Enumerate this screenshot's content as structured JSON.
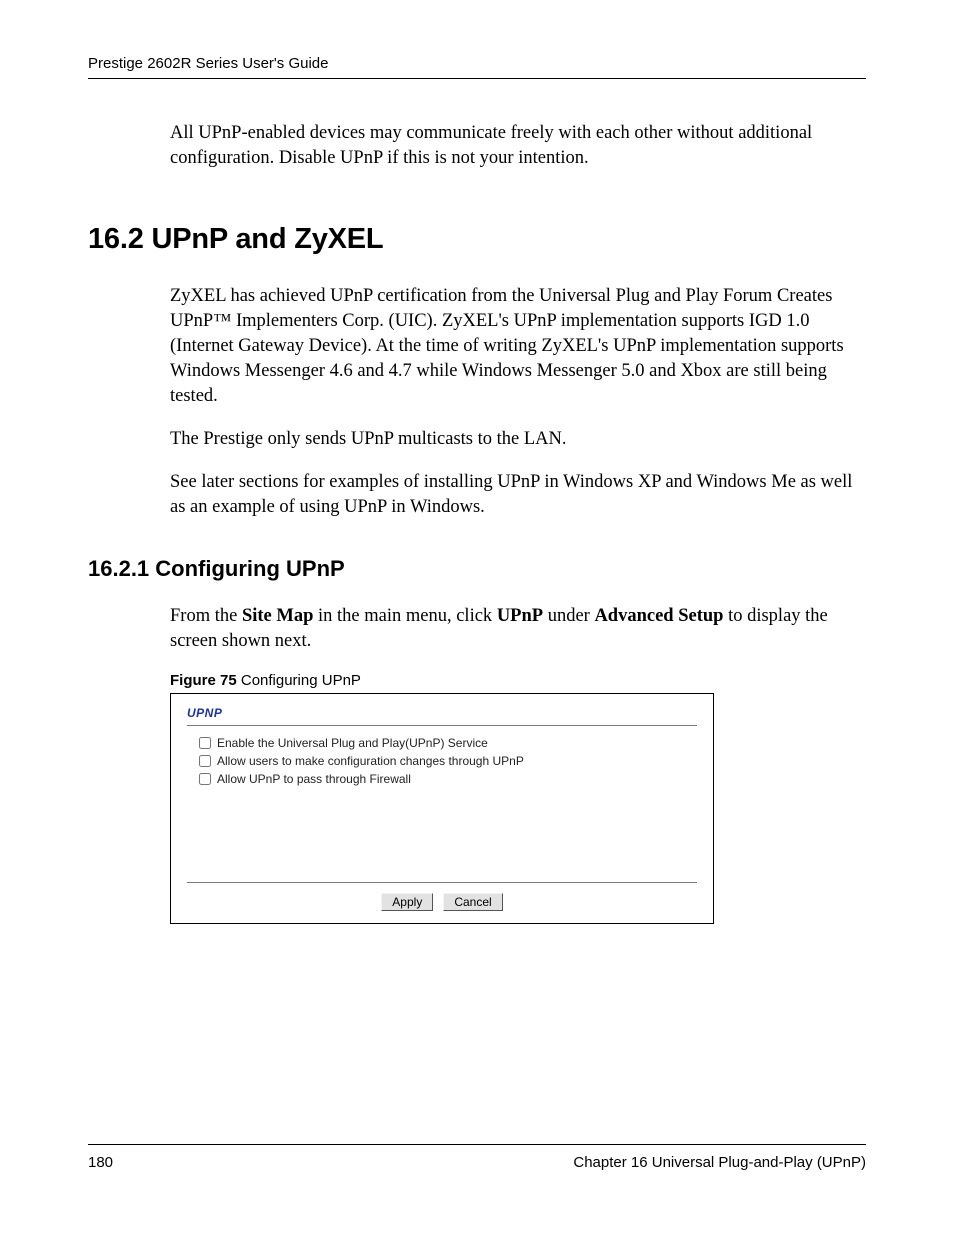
{
  "header": {
    "guide_title": "Prestige 2602R Series User's Guide"
  },
  "intro_para": "All UPnP-enabled devices may communicate freely with each other without additional configuration. Disable UPnP if this is not your intention.",
  "section_16_2": {
    "heading": "16.2  UPnP and ZyXEL",
    "para1": "ZyXEL has achieved UPnP certification from the Universal Plug and Play Forum Creates UPnP™ Implementers Corp. (UIC). ZyXEL's UPnP implementation supports IGD 1.0 (Internet Gateway Device). At the time of writing ZyXEL's UPnP implementation supports Windows Messenger 4.6 and 4.7 while Windows Messenger 5.0 and Xbox are still being tested.",
    "para2": "The Prestige only sends UPnP multicasts to the LAN.",
    "para3": "See later sections for examples of installing UPnP in Windows XP and Windows Me as well as an example of using UPnP in Windows."
  },
  "section_16_2_1": {
    "heading": "16.2.1  Configuring UPnP",
    "para_prefix": "From the ",
    "sitemap": "Site Map",
    "para_mid1": " in the main menu, click ",
    "upnp": "UPnP",
    "para_mid2": " under ",
    "advsetup": "Advanced Setup",
    "para_suffix": " to display the screen shown next."
  },
  "figure": {
    "label": "Figure 75",
    "caption": "   Configuring UPnP",
    "panel_title": "UPNP",
    "checkboxes": [
      "Enable the Universal Plug and Play(UPnP) Service",
      "Allow users to make configuration changes through UPnP",
      "Allow UPnP to pass through Firewall"
    ],
    "buttons": {
      "apply": "Apply",
      "cancel": "Cancel"
    }
  },
  "footer": {
    "page_number": "180",
    "chapter": "Chapter 16 Universal Plug-and-Play (UPnP)"
  }
}
